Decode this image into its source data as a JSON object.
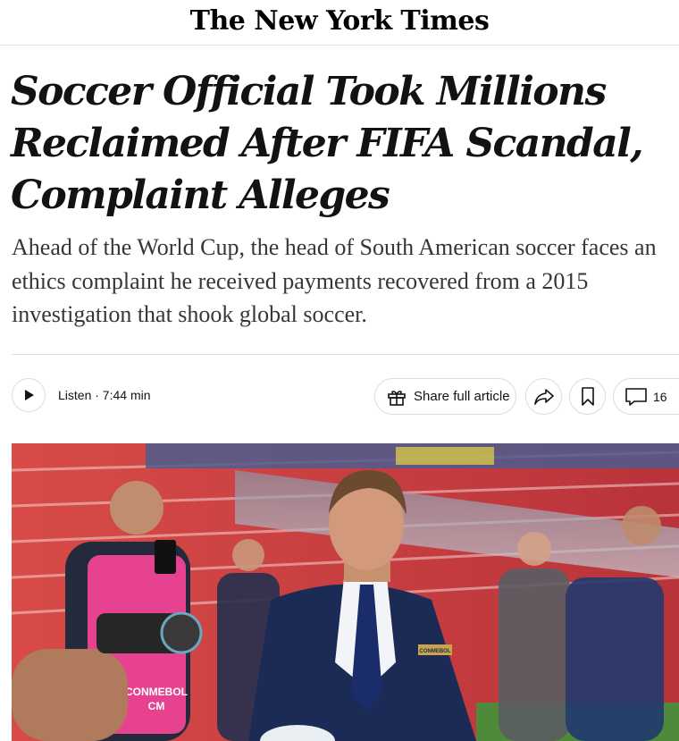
{
  "masthead": {
    "logo_text": "The New York Times"
  },
  "article": {
    "headline": "Soccer Official Took Millions Reclaimed After FIFA Scandal, Complaint Alleges",
    "summary": "Ahead of the World Cup, the head of South American soccer faces an ethics complaint he received payments recovered from a 2015 investigation that shook global soccer."
  },
  "toolbar": {
    "listen_label": "Listen · 7:44 min",
    "share_label": "Share full article",
    "comment_count": "16",
    "icons": [
      "play-icon",
      "gift-icon",
      "share-arrow-icon",
      "bookmark-icon",
      "comment-icon"
    ]
  },
  "photo": {
    "bib_text": [
      "CONMEBOL",
      "CM"
    ],
    "badge_text": "CONMEBOL",
    "colors": {
      "stands": "#c93a3a",
      "bib": "#e6428f",
      "suit": "#1c2b55"
    }
  }
}
